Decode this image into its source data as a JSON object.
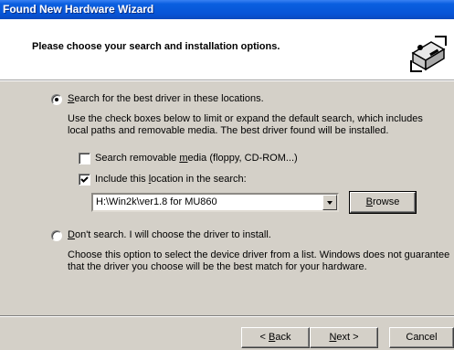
{
  "window": {
    "title": "Found New Hardware Wizard"
  },
  "header": {
    "heading": "Please choose your search and installation options.",
    "icon": "hardware-wizard-icon"
  },
  "option_search": {
    "selected": true,
    "label_pre": "",
    "label_u": "S",
    "label_post": "earch for the best driver in these locations.",
    "description": "Use the check boxes below to limit or expand the default search, which includes local paths and removable media. The best driver found will be installed.",
    "removable": {
      "checked": false,
      "label_pre": "Search removable ",
      "label_u": "m",
      "label_post": "edia (floppy, CD-ROM...)"
    },
    "include": {
      "checked": true,
      "label_pre": "Include this ",
      "label_u": "l",
      "label_post": "ocation in the search:"
    },
    "location": {
      "value": "H:\\Win2k\\ver1.8 for MU860"
    },
    "browse": {
      "label_pre": "",
      "label_u": "B",
      "label_post": "rowse"
    }
  },
  "option_manual": {
    "selected": false,
    "label_pre": "",
    "label_u": "D",
    "label_post": "on't search. I will choose the driver to install.",
    "description": "Choose this option to select the device driver from a list.  Windows does not guarantee that the driver you choose will be the best match for your hardware."
  },
  "footer": {
    "back": {
      "label_pre": "< ",
      "label_u": "B",
      "label_post": "ack"
    },
    "next": {
      "label_pre": "",
      "label_u": "N",
      "label_post": "ext >"
    },
    "cancel": {
      "label": "Cancel"
    }
  }
}
